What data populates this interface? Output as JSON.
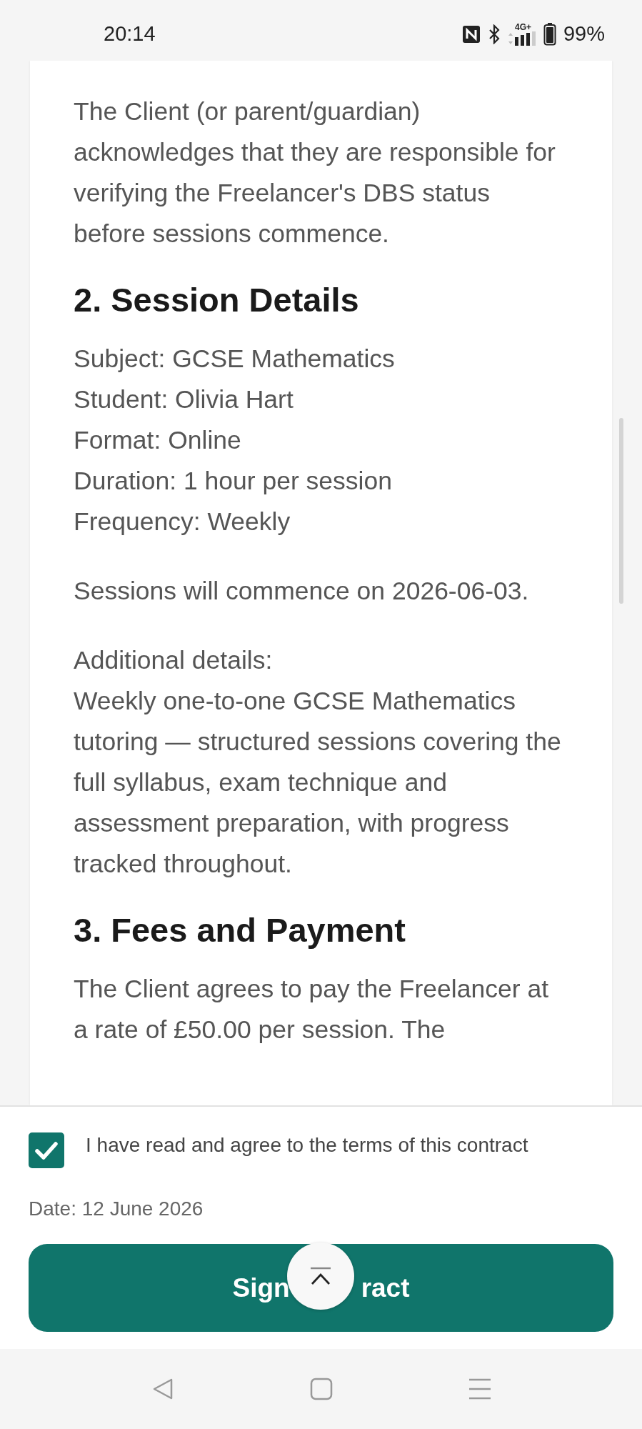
{
  "status_bar": {
    "time": "20:14",
    "network": "4G+",
    "battery": "99%"
  },
  "contract": [
    {
      "kind": "paragraph",
      "text": "The Client (or parent/guardian) acknowledges that they are responsible for verifying the Freelancer's DBS status before sessions commence."
    },
    {
      "kind": "heading",
      "text": "2. Session Details"
    },
    {
      "kind": "lines",
      "lines": [
        "Subject: GCSE Mathematics",
        "Student: Olivia Hart",
        "Format: Online",
        "Duration: 1 hour per session",
        "Frequency: Weekly"
      ]
    },
    {
      "kind": "paragraph",
      "text": "Sessions will commence on 2026-06-03."
    },
    {
      "kind": "lines",
      "lines": [
        "Additional details:",
        "Weekly one-to-one GCSE Mathematics tutoring — structured sessions covering the full syllabus, exam technique and assessment preparation, with progress tracked throughout."
      ]
    },
    {
      "kind": "heading",
      "text": "3. Fees and Payment"
    },
    {
      "kind": "paragraph",
      "text": "The Client agrees to pay the Freelancer at a rate of £50.00 per session. The"
    }
  ],
  "agreement": {
    "label": "I have read and agree to the terms of this contract",
    "checked": true
  },
  "date": "Date: 12 June 2026",
  "sign_button": {
    "visible_text": [
      "Sign",
      "ract"
    ]
  }
}
